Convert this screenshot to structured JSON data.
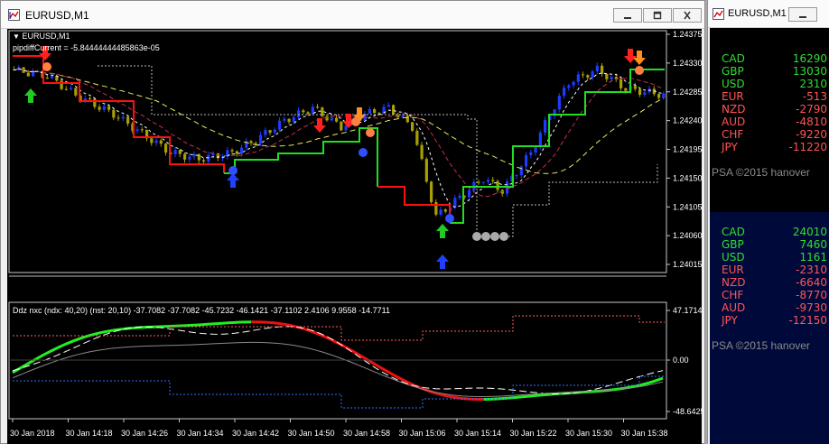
{
  "main_window": {
    "title": "EURUSD,M1",
    "symbol_label": "EURUSD,M1",
    "pipdiff_text": "pipdiffCurrent = -5.84444444485863e-05"
  },
  "price_axis": [
    "1.24375",
    "1.24330",
    "1.24285",
    "1.24240",
    "1.24195",
    "1.24150",
    "1.24105",
    "1.24060",
    "1.24015"
  ],
  "indicator": {
    "label": "Ddz nxc (ndx: 40,20) (nst: 20,10) -37.7082 -37.7082 -45.7232 -46.1421 -37.1102 2.4106 9.9558 -14.7711",
    "axis": [
      "47.1714",
      "0.00",
      "-48.6425"
    ]
  },
  "time_axis": [
    "30 Jan 2018",
    "30 Jan 14:18",
    "30 Jan 14:26",
    "30 Jan 14:34",
    "30 Jan 14:42",
    "30 Jan 14:50",
    "30 Jan 14:58",
    "30 Jan 15:06",
    "30 Jan 15:14",
    "30 Jan 15:22",
    "30 Jan 15:30",
    "30 Jan 15:38"
  ],
  "side_window": {
    "title": "EURUSD,M1",
    "panel1": [
      {
        "ccy": "CAD",
        "val": "16290",
        "color": "#33dd33"
      },
      {
        "ccy": "GBP",
        "val": "13030",
        "color": "#33dd33"
      },
      {
        "ccy": "USD",
        "val": "2310",
        "color": "#33dd33"
      },
      {
        "ccy": "EUR",
        "val": "-513",
        "color": "#ff5555"
      },
      {
        "ccy": "NZD",
        "val": "-2790",
        "color": "#ff5555"
      },
      {
        "ccy": "AUD",
        "val": "-4810",
        "color": "#ff5555"
      },
      {
        "ccy": "CHF",
        "val": "-9220",
        "color": "#ff5555"
      },
      {
        "ccy": "JPY",
        "val": "-11220",
        "color": "#ff5555"
      }
    ],
    "panel2": [
      {
        "ccy": "CAD",
        "val": "24010",
        "color": "#33dd33"
      },
      {
        "ccy": "GBP",
        "val": "7460",
        "color": "#33dd33"
      },
      {
        "ccy": "USD",
        "val": "1161",
        "color": "#33dd33"
      },
      {
        "ccy": "EUR",
        "val": "-2310",
        "color": "#ff5555"
      },
      {
        "ccy": "NZD",
        "val": "-6640",
        "color": "#ff5555"
      },
      {
        "ccy": "CHF",
        "val": "-8770",
        "color": "#ff5555"
      },
      {
        "ccy": "AUD",
        "val": "-9730",
        "color": "#ff5555"
      },
      {
        "ccy": "JPY",
        "val": "-12150",
        "color": "#ff5555"
      }
    ],
    "copyright": "PSA ©2015 hanover"
  },
  "colors": {
    "bull_candle": "#1e3cff",
    "bear_candle": "#a8a000",
    "up_arrow": "#22cc22",
    "down_arrow": "#ff2020",
    "panel2_bg": "#000a3a"
  }
}
